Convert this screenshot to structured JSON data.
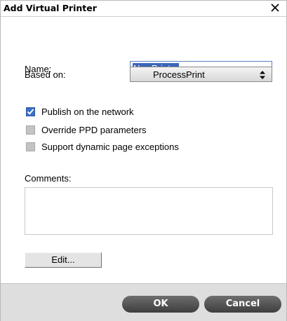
{
  "dialog": {
    "title": "Add Virtual Printer",
    "close_icon": "close-x-icon"
  },
  "form": {
    "name_label": "Name:",
    "name_value": "NewPrinter",
    "based_on_label": "Based on:",
    "based_on_value": "ProcessPrint",
    "select_icon": "updown-arrows-icon"
  },
  "options": [
    {
      "label": "Publish on the network",
      "checked": true
    },
    {
      "label": "Override PPD parameters",
      "checked": false
    },
    {
      "label": "Support dynamic page exceptions",
      "checked": false
    }
  ],
  "comments": {
    "label": "Comments:",
    "value": ""
  },
  "buttons": {
    "edit": "Edit...",
    "ok": "OK",
    "cancel": "Cancel"
  },
  "colors": {
    "checkbox_checked": "#3b6fc6",
    "checkbox_unchecked": "#c4c4c4",
    "pill_button": "#4a4a4a",
    "footer_bg": "#dedede",
    "selection_highlight": "#3a66b8"
  }
}
